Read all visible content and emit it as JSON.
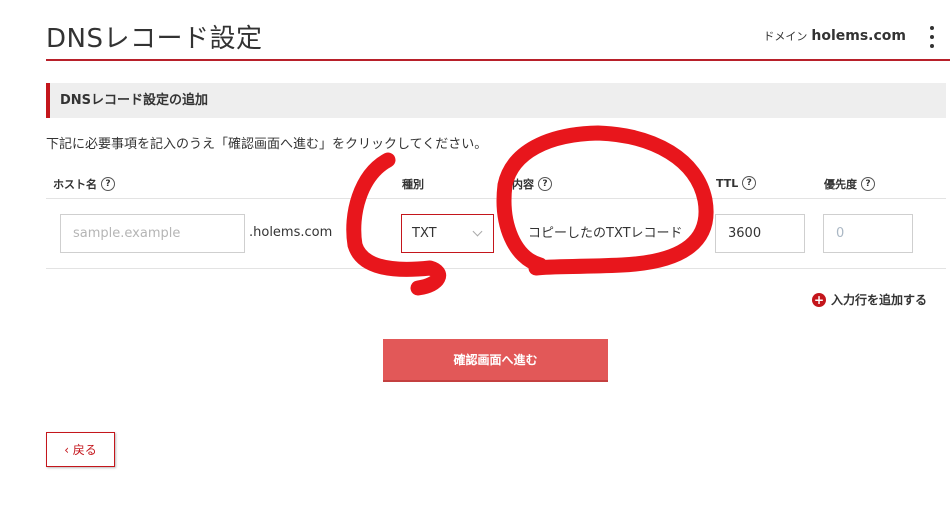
{
  "header": {
    "title": "DNSレコード設定",
    "domain_label": "ドメイン",
    "domain_name": "holems.com"
  },
  "section": {
    "heading": "DNSレコード設定の追加",
    "instruction": "下記に必要事項を記入のうえ「確認画面へ進む」をクリックしてください。"
  },
  "columns": {
    "host": "ホスト名",
    "type": "種別",
    "content": "内容",
    "ttl": "TTL",
    "priority": "優先度",
    "help_glyph": "?"
  },
  "record": {
    "host_placeholder": "sample.example",
    "domain_suffix": ".holems.com",
    "type_value": "TXT",
    "content_value": "コピーしたのTXTレコード",
    "ttl_value": "3600",
    "priority_value": "0"
  },
  "actions": {
    "add_row": "入力行を追加する",
    "add_row_glyph": "+",
    "confirm": "確認画面へ進む",
    "back": "‹ 戻る"
  },
  "colors": {
    "accent": "#c4161c",
    "button": "#e25858",
    "annotation": "#e8161c"
  }
}
